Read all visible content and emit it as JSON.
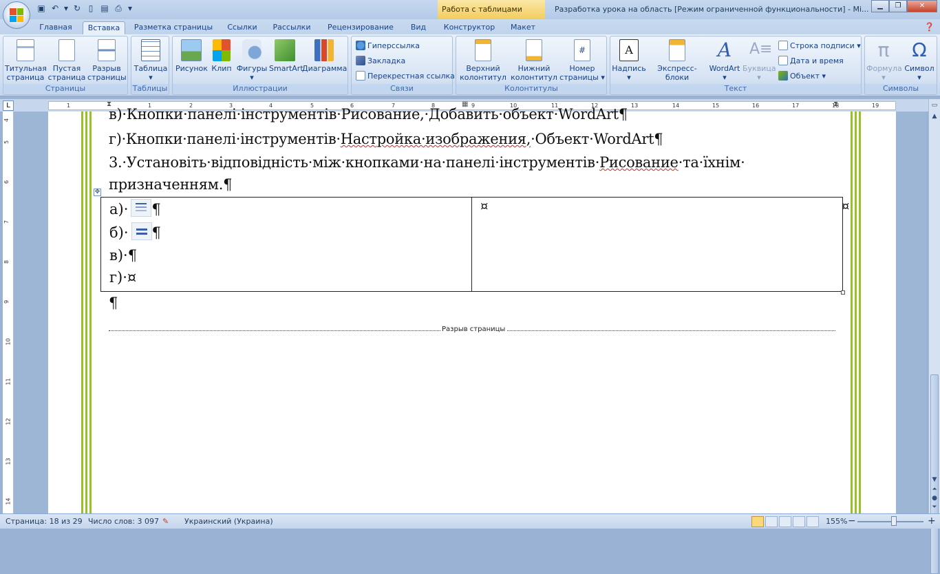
{
  "title_bar": {
    "context_tab": "Работа с таблицами",
    "window_title": "Разработка урока на область [Режим ограниченной функциональности] - Mi...",
    "window_buttons": [
      "minimize-icon",
      "restore-icon",
      "close-icon"
    ]
  },
  "quick_access": [
    "save-icon",
    "undo-icon",
    "dropdown-icon",
    "redo-icon",
    "new-icon",
    "open-icon",
    "print-preview-icon",
    "customize-icon"
  ],
  "tabs": [
    "Главная",
    "Вставка",
    "Разметка страницы",
    "Ссылки",
    "Рассылки",
    "Рецензирование",
    "Вид",
    "Конструктор",
    "Макет"
  ],
  "active_tab": "Вставка",
  "ribbon": {
    "pages": {
      "label": "Страницы",
      "buttons": [
        {
          "line1": "Титульная",
          "line2": "страница ▾"
        },
        {
          "line1": "Пустая",
          "line2": "страница"
        },
        {
          "line1": "Разрыв",
          "line2": "страницы"
        }
      ]
    },
    "tables": {
      "label": "Таблицы",
      "button": {
        "line1": "Таблица",
        "line2": "▾"
      }
    },
    "illustrations": {
      "label": "Иллюстрации",
      "buttons": [
        {
          "line1": "Рисунок",
          "line2": ""
        },
        {
          "line1": "Клип",
          "line2": ""
        },
        {
          "line1": "Фигуры",
          "line2": "▾"
        },
        {
          "line1": "SmartArt",
          "line2": ""
        },
        {
          "line1": "Диаграмма",
          "line2": ""
        }
      ]
    },
    "links": {
      "label": "Связи",
      "items": [
        "Гиперссылка",
        "Закладка",
        "Перекрестная ссылка"
      ]
    },
    "header_footer": {
      "label": "Колонтитулы",
      "buttons": [
        {
          "line1": "Верхний",
          "line2": "колонтитул ▾"
        },
        {
          "line1": "Нижний",
          "line2": "колонтитул ▾"
        },
        {
          "line1": "Номер",
          "line2": "страницы ▾"
        }
      ]
    },
    "text": {
      "label": "Текст",
      "buttons": [
        {
          "line1": "Надпись",
          "line2": "▾"
        },
        {
          "line1": "Экспресс-блоки",
          "line2": "▾"
        },
        {
          "line1": "WordArt",
          "line2": "▾"
        },
        {
          "line1": "Буквица",
          "line2": "▾"
        }
      ],
      "side_items": [
        "Строка подписи ▾",
        "Дата и время",
        "Объект ▾"
      ]
    },
    "symbols": {
      "label": "Символы",
      "buttons": [
        {
          "line1": "Формула",
          "line2": "▾"
        },
        {
          "line1": "Символ",
          "line2": "▾"
        }
      ]
    }
  },
  "ruler": {
    "numbers": [
      "1",
      "1",
      "2",
      "3",
      "4",
      "5",
      "6",
      "7",
      "8",
      "9",
      "10",
      "11",
      "12",
      "13",
      "14",
      "15",
      "16",
      "17",
      "18",
      "19"
    ],
    "vertical_numbers": [
      "4",
      "5",
      "6",
      "7",
      "8",
      "9",
      "10",
      "11",
      "12",
      "13",
      "14"
    ]
  },
  "document": {
    "line_v": "в)·Кнопки·панелі·інструментів·Рисование,·Добавить·объект·WordArt¶",
    "line_g_parts": [
      "г)·Кнопки·панелі·інструментів·",
      "Настройка·изображения,",
      "·Объект·WordArt¶"
    ],
    "line_3a_parts": [
      "3.·Установіть·відповідність·між·кнопками·на·панелі·інструментів·",
      "Рисование",
      "·та·їхнім·"
    ],
    "line_3b": "призначенням.¶",
    "table": {
      "left_lines": [
        "а)·",
        "б)·",
        "в)·¶",
        "г)·¤"
      ],
      "pilcrow": "¶",
      "right_cell": "¤",
      "end_of_row": "¤"
    },
    "after_table": "¶",
    "page_break": "Разрыв страницы"
  },
  "status_bar": {
    "page": "Страница: 18 из 29",
    "words": "Число слов: 3 097",
    "language": "Украинский (Украина)",
    "zoom": "155%",
    "zoom_minus": "−",
    "zoom_plus": "+"
  }
}
